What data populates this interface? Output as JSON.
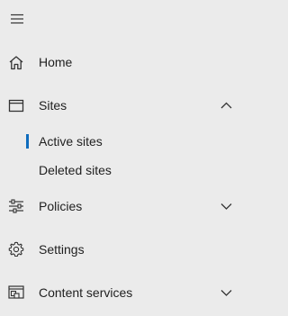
{
  "menu": {
    "toggle_icon": "hamburger-icon"
  },
  "nav": {
    "items": [
      {
        "label": "Home",
        "icon": "home-icon"
      },
      {
        "label": "Sites",
        "icon": "sites-icon",
        "expanded": true,
        "children": [
          {
            "label": "Active sites",
            "selected": true
          },
          {
            "label": "Deleted sites",
            "selected": false
          }
        ]
      },
      {
        "label": "Policies",
        "icon": "sliders-icon",
        "expanded": false
      },
      {
        "label": "Settings",
        "icon": "gear-icon"
      },
      {
        "label": "Content services",
        "icon": "content-services-icon",
        "expanded": false
      }
    ]
  },
  "colors": {
    "background": "#ebebeb",
    "text": "#1f1f1f",
    "accent": "#0f6cbd"
  }
}
